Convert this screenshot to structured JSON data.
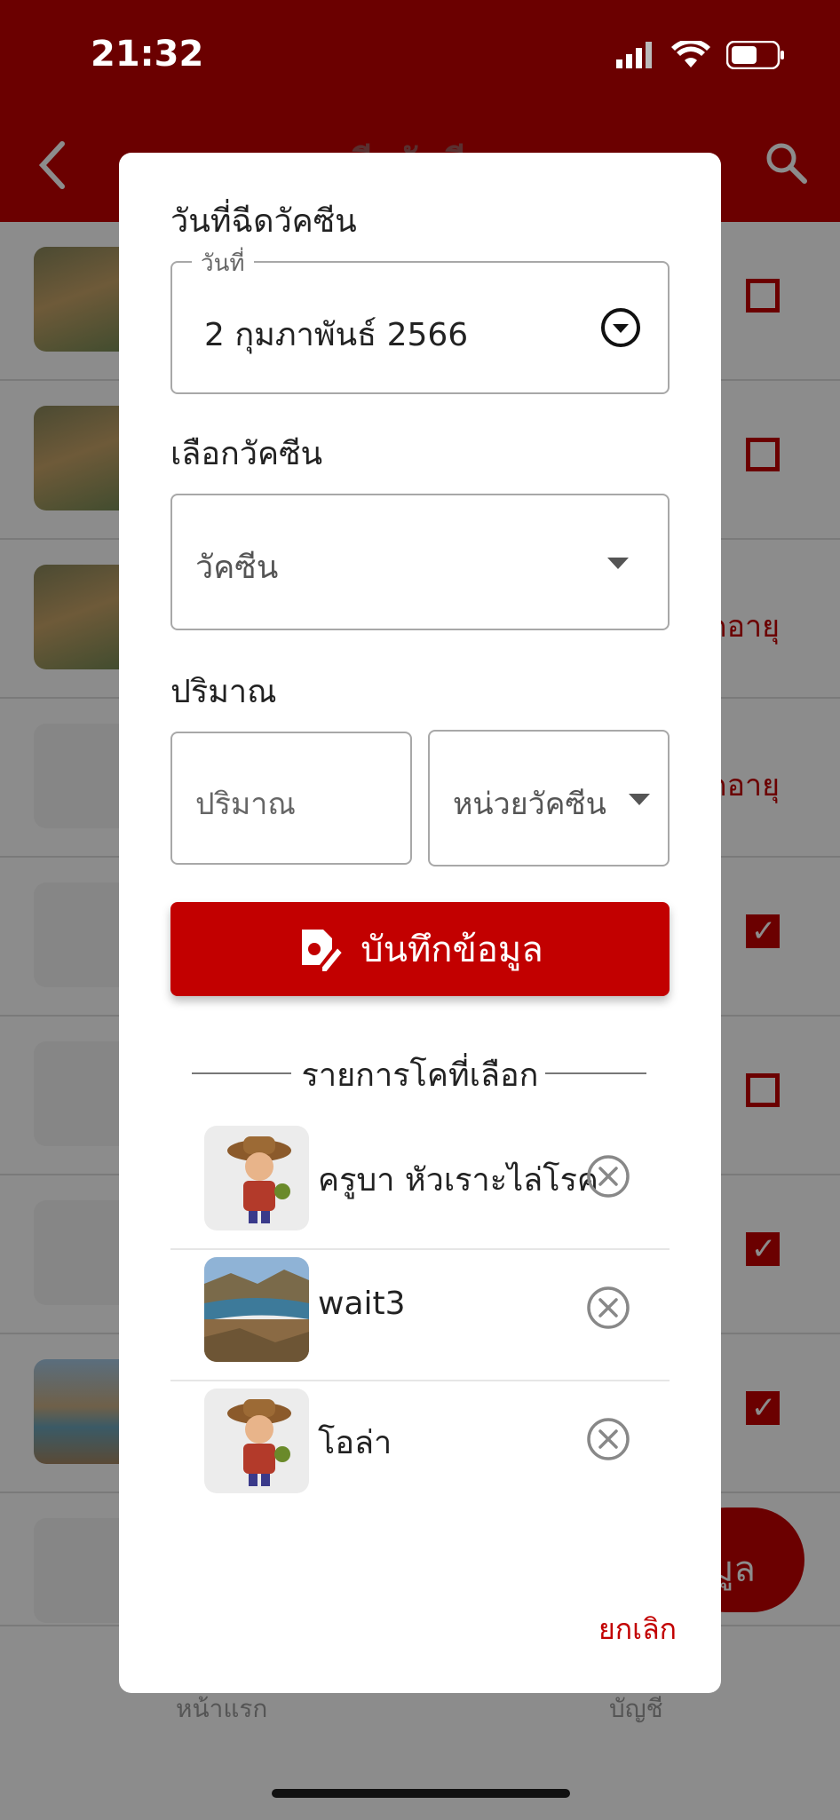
{
  "status_bar": {
    "time": "21:32"
  },
  "header": {
    "title": "ฉีดวัคซีน"
  },
  "background_list": {
    "rows": [
      {
        "thumb": "photo-cow",
        "status": "checkbox-empty"
      },
      {
        "thumb": "photo-cow",
        "status": "checkbox-empty"
      },
      {
        "thumb": "photo-cow",
        "status": "text",
        "text": "ดอายุ"
      },
      {
        "thumb": "mascot",
        "status": "text",
        "text": "ดอายุ"
      },
      {
        "thumb": "mascot",
        "status": "checkbox-checked"
      },
      {
        "thumb": "mascot",
        "status": "checkbox-empty"
      },
      {
        "thumb": "mascot",
        "status": "checkbox-checked"
      },
      {
        "thumb": "photo-lake",
        "status": "checkbox-checked"
      },
      {
        "thumb": "mascot",
        "status": "none"
      }
    ]
  },
  "fab": {
    "label": "มูล"
  },
  "bottom_nav": {
    "home": "หน้าแรก",
    "account": "บัญชี"
  },
  "modal": {
    "date_section_label": "วันที่ฉีดวัคซีน",
    "date_field": {
      "legend": "วันที่",
      "value": "2 กุมภาพันธ์ 2566"
    },
    "vaccine_section_label": "เลือกวัคซีน",
    "vaccine_field": {
      "placeholder": "วัคซีน"
    },
    "amount_section_label": "ปริมาณ",
    "amount_field": {
      "placeholder": "ปริมาณ"
    },
    "unit_field": {
      "placeholder": "หน่วยวัคซีน"
    },
    "save_button": {
      "label": "บันทึกข้อมูล"
    },
    "selected_title": "รายการโคที่เลือก",
    "selected_cows": [
      {
        "name": "ครูบา  หัวเราะไล่โรค",
        "thumb": "mascot"
      },
      {
        "name": "wait3",
        "thumb": "photo-lake"
      },
      {
        "name": "โอล่า",
        "thumb": "mascot"
      }
    ],
    "cancel_label": "ยกเลิก"
  },
  "colors": {
    "primary_red": "#c20000",
    "header_dark_red": "#6b0000"
  }
}
